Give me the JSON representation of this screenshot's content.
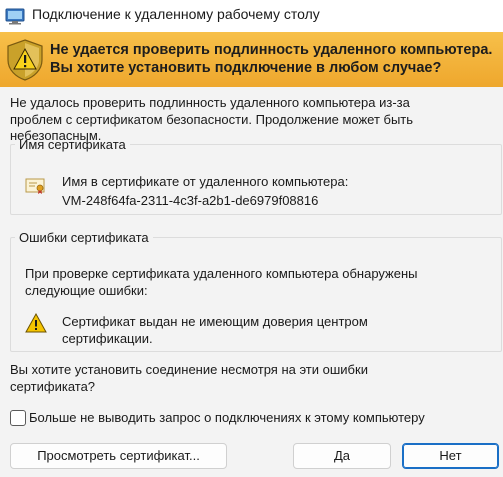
{
  "window": {
    "title": "Подключение к удаленному рабочему столу",
    "title_icon": "rdp-monitor-icon"
  },
  "banner": {
    "icon": "security-shield-warning-icon",
    "line1": "Не удается проверить подлинность удаленного компьютера.",
    "line2": "Вы хотите установить подключение в любом случае?",
    "color": "#f2b33a"
  },
  "intro": {
    "line1": "Не удалось проверить подлинность удаленного компьютера из-за",
    "line2": "проблем с сертификатом безопасности. Продолжение может быть",
    "line3": "небезопасным."
  },
  "certificate_group": {
    "legend": "Имя сертификата",
    "icon": "certificate-icon",
    "label": "Имя в сертификате от удаленного компьютера:",
    "value": "VM-248f64fa-2311-4c3f-a2b1-de6979f08816"
  },
  "errors_group": {
    "legend": "Ошибки сертификата",
    "desc_line1": "При проверке сертификата удаленного компьютера обнаружены",
    "desc_line2": "следующие ошибки:",
    "error_icon": "warning-triangle-icon",
    "error_line1": "Сертификат выдан не имеющим доверия центром",
    "error_line2": "сертификации."
  },
  "question": {
    "line1": "Вы хотите установить соединение несмотря на эти ошибки",
    "line2": "сертификата?"
  },
  "dont_ask": {
    "label": "Больше не выводить запрос о подключениях к этому компьютеру",
    "checked": false
  },
  "buttons": {
    "view_certificate": "Просмотреть сертификат...",
    "yes": "Да",
    "no": "Нет"
  },
  "colors": {
    "accent": "#1a6fc6",
    "warning_yellow": "#f5c400",
    "background": "#f3f3f3"
  }
}
